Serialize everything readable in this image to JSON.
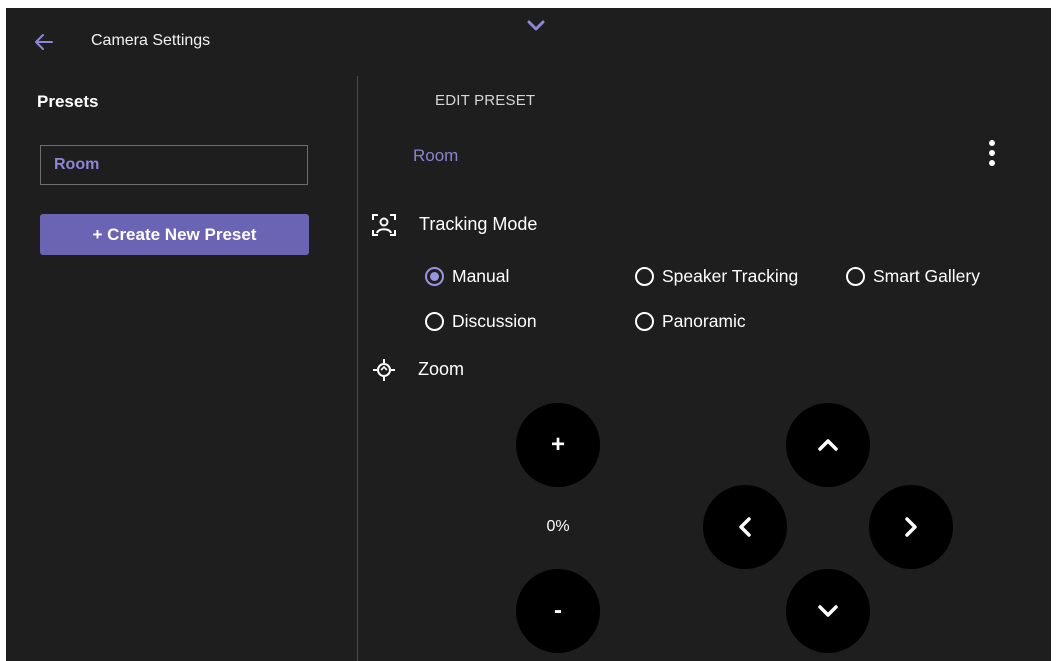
{
  "header": {
    "title": "Camera Settings",
    "back_icon": "arrow-left-icon",
    "pull_icon": "chevron-down-icon"
  },
  "colors": {
    "accent": "#6b64b5",
    "accent_text": "#8a84cf",
    "background": "#1e1e1e",
    "button_bg": "#000000"
  },
  "presets": {
    "title": "Presets",
    "items": [
      {
        "label": "Room"
      }
    ],
    "create_label": "+ Create New Preset"
  },
  "edit": {
    "title": "EDIT PRESET",
    "preset_name": "Room",
    "more_icon": "more-vertical-icon"
  },
  "tracking": {
    "label": "Tracking Mode",
    "icon": "face-tracking-icon",
    "options": [
      {
        "label": "Manual",
        "selected": true
      },
      {
        "label": "Speaker Tracking",
        "selected": false
      },
      {
        "label": "Smart Gallery",
        "selected": false
      },
      {
        "label": "Discussion",
        "selected": false
      },
      {
        "label": "Panoramic",
        "selected": false
      }
    ]
  },
  "zoom": {
    "label": "Zoom",
    "icon": "zoom-icon",
    "plus_label": "+",
    "minus_label": "-",
    "value": "0%"
  },
  "pan_tilt": {
    "up_icon": "chevron-up-icon",
    "down_icon": "chevron-down-icon",
    "left_icon": "chevron-left-icon",
    "right_icon": "chevron-right-icon"
  }
}
